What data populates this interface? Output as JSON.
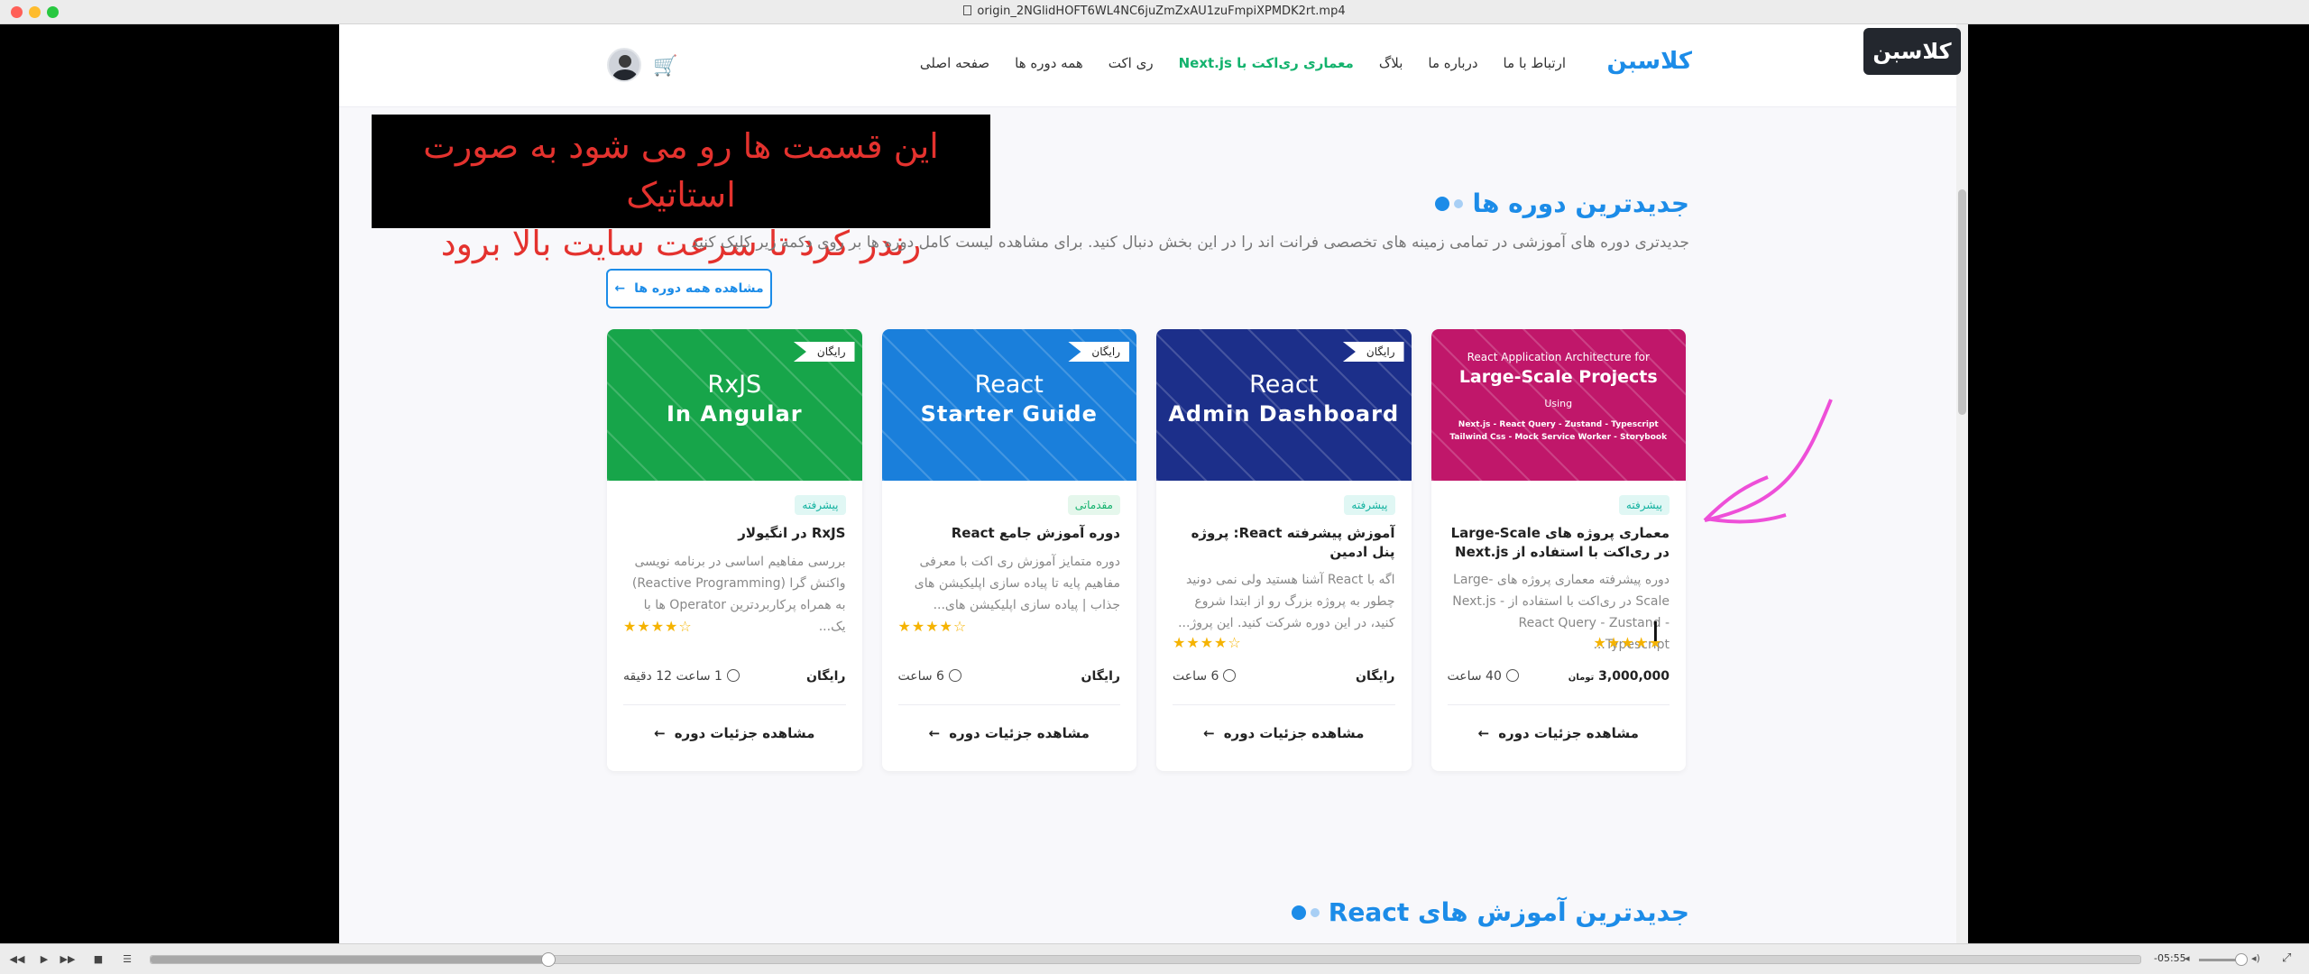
{
  "window": {
    "title": "origin_2NGlidHOFT6WL4NC6juZmZxAU1zuFmpiXPMDK2rt.mp4"
  },
  "site": {
    "logo": "کلاسبن",
    "nav": [
      "صفحه اصلی",
      "همه دوره ها",
      "ری اکت",
      "معماری ری‌اکت با Next.js",
      "بلاگ",
      "درباره ما",
      "ارتباط با ما"
    ],
    "active_nav_index": 3,
    "cart_icon": "cart-icon",
    "avatar": "user-avatar"
  },
  "overlay_banner": {
    "line1": "این قسمت ها رو می شود به صورت استاتیک",
    "line2": "رندر کرد تا سرعت سایت بالا برود"
  },
  "watermark": "کلاسبن",
  "section": {
    "title": "جدیدترین دوره ها",
    "subtitle": "جدیدتری دوره های آموزشی در تمامی زمینه های تخصصی فرانت اند را در این بخش دنبال کنید. برای مشاهده لیست کامل دوره ها بر روی دکمه زیر کلیک کنید",
    "view_all": "مشاهده همه دوره ها"
  },
  "cards": [
    {
      "thumb_l1": "React Application Architecture for",
      "thumb_l2": "Large-Scale Projects",
      "thumb_l3": "Using",
      "thumb_l4": "Next.js - React Query - Zustand - Typescript",
      "thumb_l5": "Tailwind Css - Mock Service Worker - Storybook",
      "thumb_color": "#c0176a",
      "free_tag": "",
      "level": "پیشرفته",
      "title": "معماری پروژه های Large-Scale در ری‌اکت با استفاده از Next.js",
      "desc": "دوره پیشرفته معماری پروژه های Large-Scale در ری‌اکت با استفاده از Next.js - React Query - Zustand - Typescript...",
      "stars": "★★★★★",
      "duration": "40 ساعت",
      "price": "3,000,000",
      "currency": "تومان",
      "details": "مشاهده جزئیات دوره"
    },
    {
      "thumb_l1": "React",
      "thumb_l2": "Admin Dashboard",
      "thumb_color": "#1c2f8a",
      "free_tag": "رایگان",
      "level": "پیشرفته",
      "title": "آموزش پیشرفته React: پروژه پنل ادمین",
      "desc": "اگه با React آشنا هستید ولی نمی دونید چطور به پروژه بزرگ رو از ابتدا شروع کنید، در این دوره شرکت کنید. این پروژ...",
      "stars": "★★★★☆",
      "duration": "6 ساعت",
      "price": "رایگان",
      "details": "مشاهده جزئیات دوره"
    },
    {
      "thumb_l1": "React",
      "thumb_l2": "Starter Guide",
      "thumb_color": "#1a7fdb",
      "free_tag": "رایگان",
      "level": "مقدماتی",
      "title": "دوره آموزش جامع React",
      "desc": "دوره متمایز آموزش ری اکت با معرفی مفاهیم پایه تا پیاده سازی اپلیکیشن های جذاب | پیاده سازی اپلیکیشن های...",
      "stars": "★★★★☆",
      "duration": "6 ساعت",
      "price": "رایگان",
      "details": "مشاهده جزئیات دوره"
    },
    {
      "thumb_l1": "RxJS",
      "thumb_l2": "In Angular",
      "thumb_color": "#17a54a",
      "free_tag": "رایگان",
      "level": "پیشرفته",
      "title": "RxJS در انگیولار",
      "desc": "بررسی مفاهیم اساسی در برنامه نویسی واکنش گرا (Reactive Programming) به همراه پرکاربردترین Operator ها با یک...",
      "stars": "★★★★☆",
      "duration": "1 ساعت 12 دقیقه",
      "price": "رایگان",
      "details": "مشاهده جزئیات دوره"
    }
  ],
  "section2": {
    "title": "جدیدترین آموزش های React"
  },
  "player": {
    "remaining": "-05:55",
    "progress_fraction": 0.2
  }
}
